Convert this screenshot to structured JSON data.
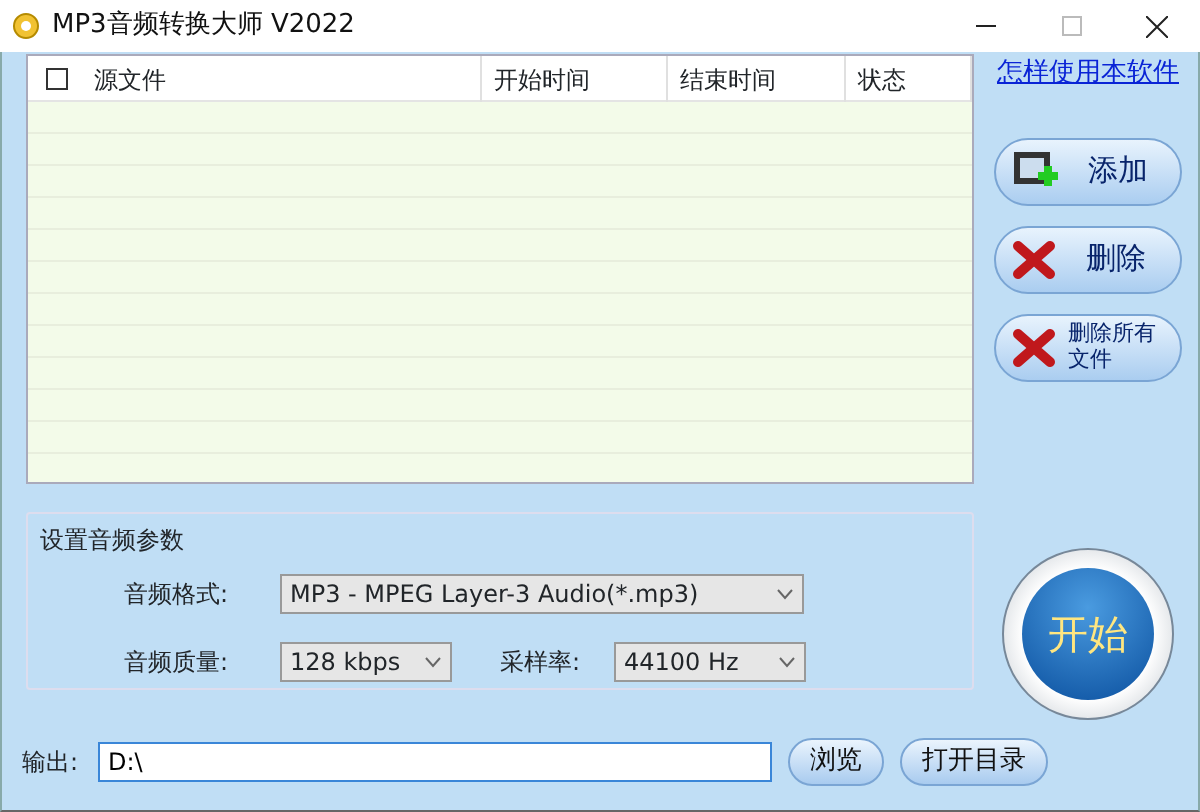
{
  "window": {
    "title": "MP3音频转换大师 V2022"
  },
  "file_table": {
    "select_all_checked": false,
    "columns": [
      "源文件",
      "开始时间",
      "结束时间",
      "状态"
    ]
  },
  "help_link": "怎样使用本软件",
  "side_buttons": [
    {
      "label": "添加",
      "kind": "add"
    },
    {
      "label": "删除",
      "kind": "delete"
    },
    {
      "label": "删除所有文件",
      "kind": "delete"
    }
  ],
  "settings": {
    "title": "设置音频参数",
    "format_label": "音频格式:",
    "format": "MP3 - MPEG Layer-3 Audio(*.mp3)",
    "quality_label": "音频质量:",
    "quality": "128 kbps",
    "rate_label": "采样率:",
    "rate": "44100 Hz"
  },
  "start_button": "开始",
  "output": {
    "label": "输出:",
    "value": "D:\\"
  },
  "bottom_buttons": [
    "浏览",
    "打开目录"
  ]
}
